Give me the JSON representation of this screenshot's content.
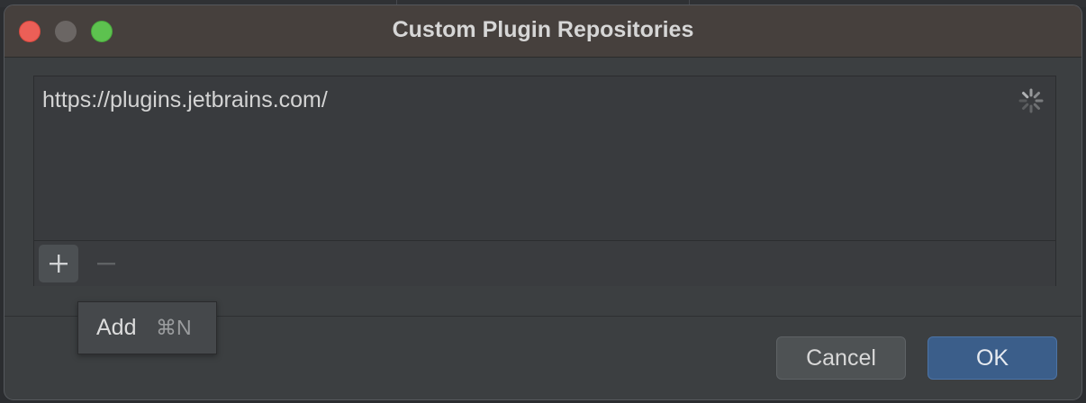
{
  "dialog": {
    "title": "Custom Plugin Repositories",
    "window_controls": {
      "close_icon": "close-circle-icon",
      "minimize_icon": "minimize-circle-icon",
      "maximize_icon": "maximize-circle-icon",
      "close_color": "#ec5f57",
      "minimize_color": "#6b6664",
      "maximize_color": "#5dc24f"
    }
  },
  "repositories": {
    "items": [
      {
        "url": "https://plugins.jetbrains.com/"
      }
    ],
    "loading_icon": "spinner-icon"
  },
  "toolbar": {
    "add_icon": "plus-icon",
    "remove_icon": "minus-icon"
  },
  "popup": {
    "label": "Add",
    "shortcut": "⌘N"
  },
  "buttons": {
    "cancel_label": "Cancel",
    "ok_label": "OK",
    "ok_color": "#3b5e8a"
  }
}
